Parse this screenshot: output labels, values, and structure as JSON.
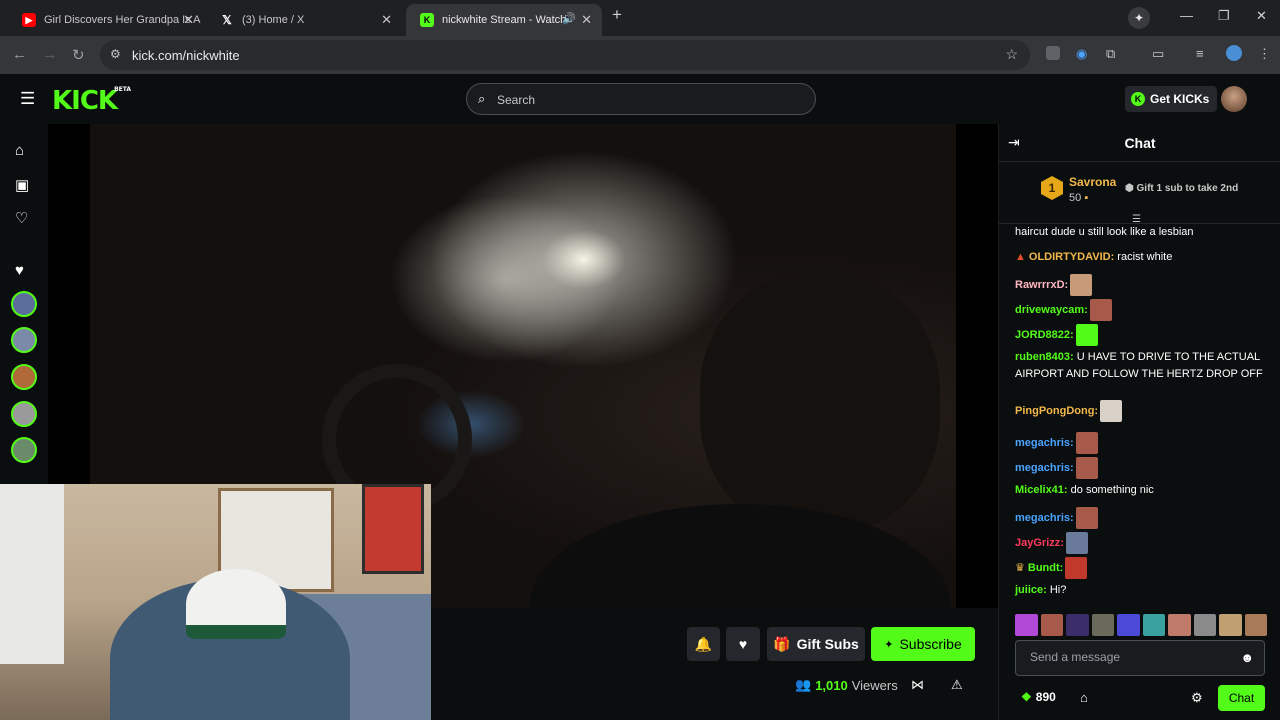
{
  "browser": {
    "tabs": [
      {
        "title": "Girl Discovers Her Grandpa Is A",
        "icon": "youtube-icon",
        "color": "#ff0000"
      },
      {
        "title": "(3) Home / X",
        "icon": "x-icon",
        "color": "#ffffff"
      },
      {
        "title": "nickwhite Stream - Watch L",
        "icon": "kick-icon",
        "color": "#53fc18",
        "active": true
      }
    ],
    "url": "kick.com/nickwhite"
  },
  "header": {
    "logo_text": "KICK",
    "logo_badge": "BETA",
    "search_placeholder": "Search",
    "get_kicks_label": "Get KICKs"
  },
  "stream_controls": {
    "gift_subs_label": "Gift Subs",
    "subscribe_label": "Subscribe",
    "viewer_count": "1,010",
    "viewers_label": "Viewers"
  },
  "chat": {
    "title": "Chat",
    "pinned": {
      "rank": "1",
      "name": "Savrona",
      "amount": "50",
      "gift_text": "Gift 1 sub to take 2nd"
    },
    "messages": [
      {
        "user": "",
        "text": "haircut dude u still look like a lesbian",
        "color": "#ffffff"
      },
      {
        "user": "OLDIRTYDAVID:",
        "text": " racist white",
        "color": "#f2b84b",
        "badge": "mc"
      },
      {
        "user": "RawrrrxD:",
        "text": "",
        "color": "#ffb6c1",
        "emote": "#c79b7a"
      },
      {
        "user": "drivewaycam:",
        "text": "",
        "color": "#53fc18",
        "emote": "#a85a4a"
      },
      {
        "user": "JORD8822:",
        "text": "",
        "color": "#53fc18",
        "emote": "#53fc18"
      },
      {
        "user": "ruben8403:",
        "text": " U HAVE TO DRIVE TO THE ACTUAL AIRPORT AND FOLLOW THE HERTZ DROP OFF",
        "color": "#53fc18"
      },
      {
        "user": "PingPongDong:",
        "text": "",
        "color": "#f2b84b",
        "emote": "#d9d0c8"
      },
      {
        "user": "megachris:",
        "text": "",
        "color": "#4aa3ff",
        "emote": "#a85a4a"
      },
      {
        "user": "megachris:",
        "text": "",
        "color": "#4aa3ff",
        "emote": "#a85a4a"
      },
      {
        "user": "Micelix41:",
        "text": " do something nic",
        "color": "#53fc18"
      },
      {
        "user": "megachris:",
        "text": "",
        "color": "#4aa3ff",
        "emote": "#a85a4a"
      },
      {
        "user": "JayGrizz:",
        "text": "",
        "color": "#ff3b5c",
        "emote": "#6a7a9a"
      },
      {
        "user": "Bundt:",
        "text": "",
        "color": "#53fc18",
        "emote": "#c0392b",
        "badge": "crown"
      },
      {
        "user": "juiice:",
        "text": " Hi?",
        "color": "#53fc18"
      }
    ],
    "input_placeholder": "Send a message",
    "points": "890",
    "chat_button_label": "Chat"
  }
}
